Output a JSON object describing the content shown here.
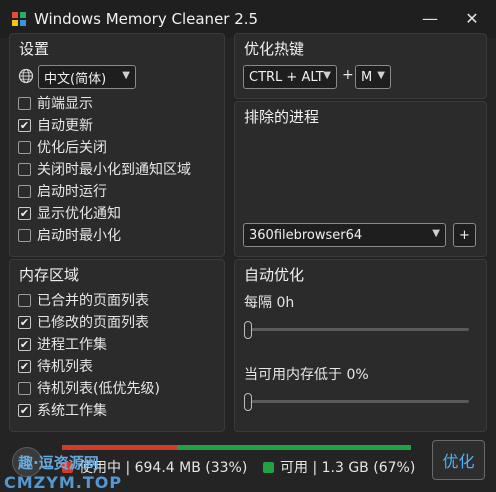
{
  "window": {
    "title": "Windows Memory Cleaner 2.5",
    "minimize": "—",
    "close": "✕"
  },
  "settings": {
    "title": "设置",
    "language": "中文(简体)",
    "options": [
      {
        "label": "前端显示",
        "checked": false
      },
      {
        "label": "自动更新",
        "checked": true
      },
      {
        "label": "优化后关闭",
        "checked": false
      },
      {
        "label": "关闭时最小化到通知区域",
        "checked": false
      },
      {
        "label": "启动时运行",
        "checked": false
      },
      {
        "label": "显示优化通知",
        "checked": true
      },
      {
        "label": "启动时最小化",
        "checked": false
      }
    ]
  },
  "hotkey": {
    "title": "优化热键",
    "modifier": "CTRL + ALT",
    "plus": "+",
    "key": "M"
  },
  "excluded": {
    "title": "排除的进程",
    "process": "360filebrowser64",
    "add": "+"
  },
  "memory_areas": {
    "title": "内存区域",
    "options": [
      {
        "label": "已合并的页面列表",
        "checked": false
      },
      {
        "label": "已修改的页面列表",
        "checked": true
      },
      {
        "label": "进程工作集",
        "checked": true
      },
      {
        "label": "待机列表",
        "checked": true
      },
      {
        "label": "待机列表(低优先级)",
        "checked": false
      },
      {
        "label": "系统工作集",
        "checked": true
      }
    ]
  },
  "auto_opt": {
    "title": "自动优化",
    "interval_label": "每隔 0h",
    "interval_value": 0,
    "low_mem_label": "当可用内存低于 0%",
    "low_mem_value": 0
  },
  "status": {
    "used_label": "使用中 | 694.4 MB (33%)",
    "free_label": "可用 | 1.3 GB (67%)",
    "used_percent": 33,
    "colors": {
      "used": "#d23b2a",
      "free": "#21a344",
      "accent": "#4db1f5"
    }
  },
  "optimize_button": "优化",
  "watermark": {
    "top": "趣·逗资源网",
    "bottom": "CMZYM.TOP"
  },
  "check_mark": "✔"
}
